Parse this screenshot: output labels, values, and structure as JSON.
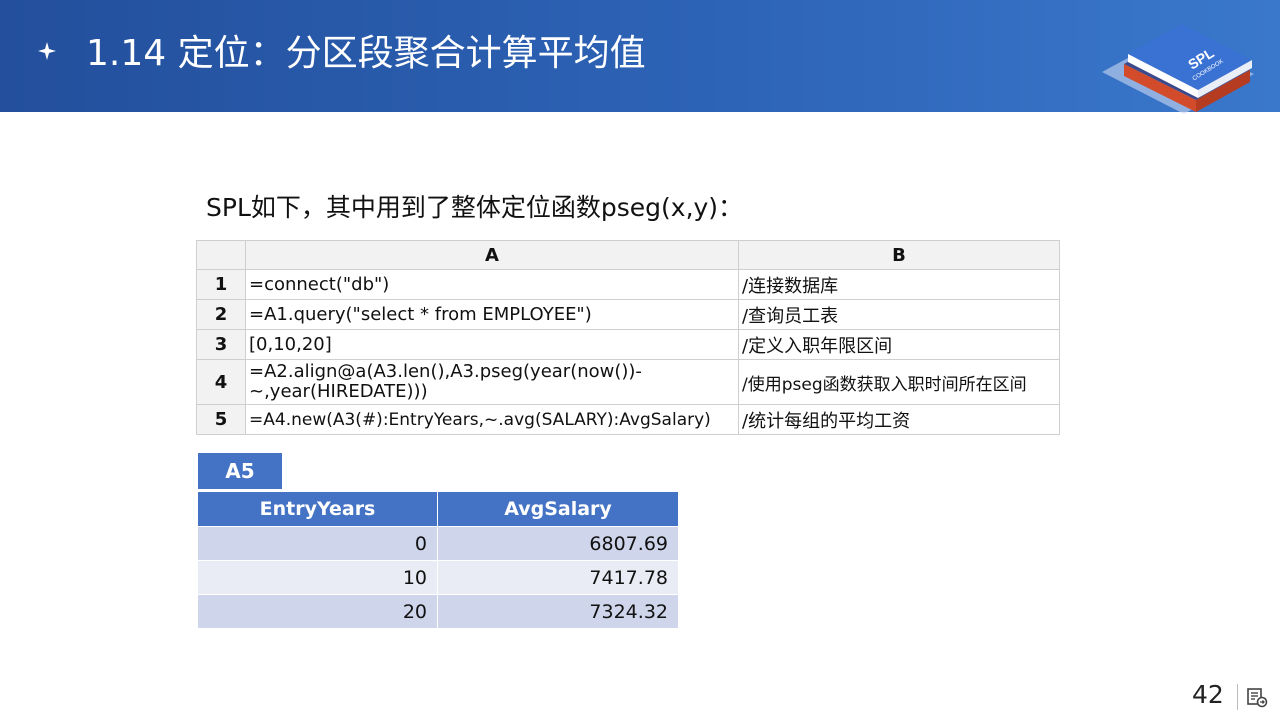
{
  "header": {
    "title": "1.14  定位：分区段聚合计算平均值",
    "logo_text_main": "SPL",
    "logo_text_sub": "COOKBOOK"
  },
  "intro": "SPL如下，其中用到了整体定位函数pseg(x,y)：",
  "grid": {
    "columns": [
      "A",
      "B"
    ],
    "rows": [
      {
        "num": "1",
        "a": "=connect(\"db\")",
        "b": "/连接数据库"
      },
      {
        "num": "2",
        "a": "=A1.query(\"select * from EMPLOYEE\")",
        "b": "/查询员工表"
      },
      {
        "num": "3",
        "a": "[0,10,20]",
        "b": "/定义入职年限区间"
      },
      {
        "num": "4",
        "a": "=A2.align@a(A3.len(),A3.pseg(year(now())-~,year(HIREDATE)))",
        "b": "/使用pseg函数获取入职时间所在区间"
      },
      {
        "num": "5",
        "a": "=A4.new(A3(#):EntryYears,~.avg(SALARY):AvgSalary)",
        "b": "/统计每组的平均工资"
      }
    ]
  },
  "result": {
    "label": "A5",
    "headers": [
      "EntryYears",
      "AvgSalary"
    ],
    "rows": [
      [
        "0",
        "6807.69"
      ],
      [
        "10",
        "7417.78"
      ],
      [
        "20",
        "7324.32"
      ]
    ]
  },
  "footer": {
    "page_number": "42"
  },
  "colors": {
    "header_blue": "#2d63b6",
    "table_header_blue": "#4472c4"
  }
}
